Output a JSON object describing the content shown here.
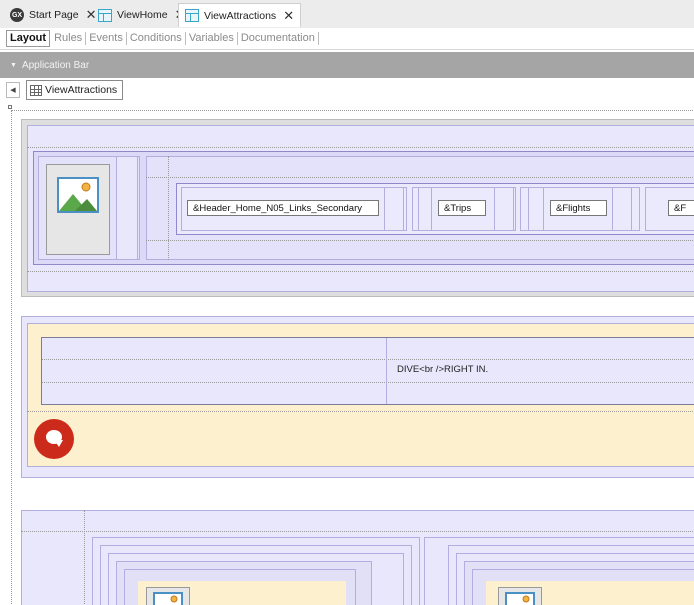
{
  "tabs": [
    {
      "label": "Start Page",
      "icon": "genexus-icon",
      "active": false
    },
    {
      "label": "ViewHome",
      "icon": "view-object-icon",
      "active": false
    },
    {
      "label": "ViewAttractions",
      "icon": "view-object-icon",
      "active": true
    }
  ],
  "subtabs": {
    "layout": "Layout",
    "rules": "Rules",
    "events": "Events",
    "conditions": "Conditions",
    "variables": "Variables",
    "documentation": "Documentation"
  },
  "app_bar": {
    "label": "Application Bar"
  },
  "breadcrumb": {
    "label": "ViewAttractions"
  },
  "header": {
    "links": [
      {
        "label": "&Header_Home_N05_Links_Secondary"
      },
      {
        "label": "&Trips"
      },
      {
        "label": "&Flights"
      },
      {
        "label": "&F"
      }
    ]
  },
  "banner": {
    "text": "DIVE<br />RIGHT IN."
  },
  "colors": {
    "tab_bar": "#ececec",
    "app_bar": "#a5a5a5",
    "table_fill": "#e9e7fb",
    "cream_fill": "#fdf0cf",
    "bubble_red": "#cc2a1b"
  }
}
